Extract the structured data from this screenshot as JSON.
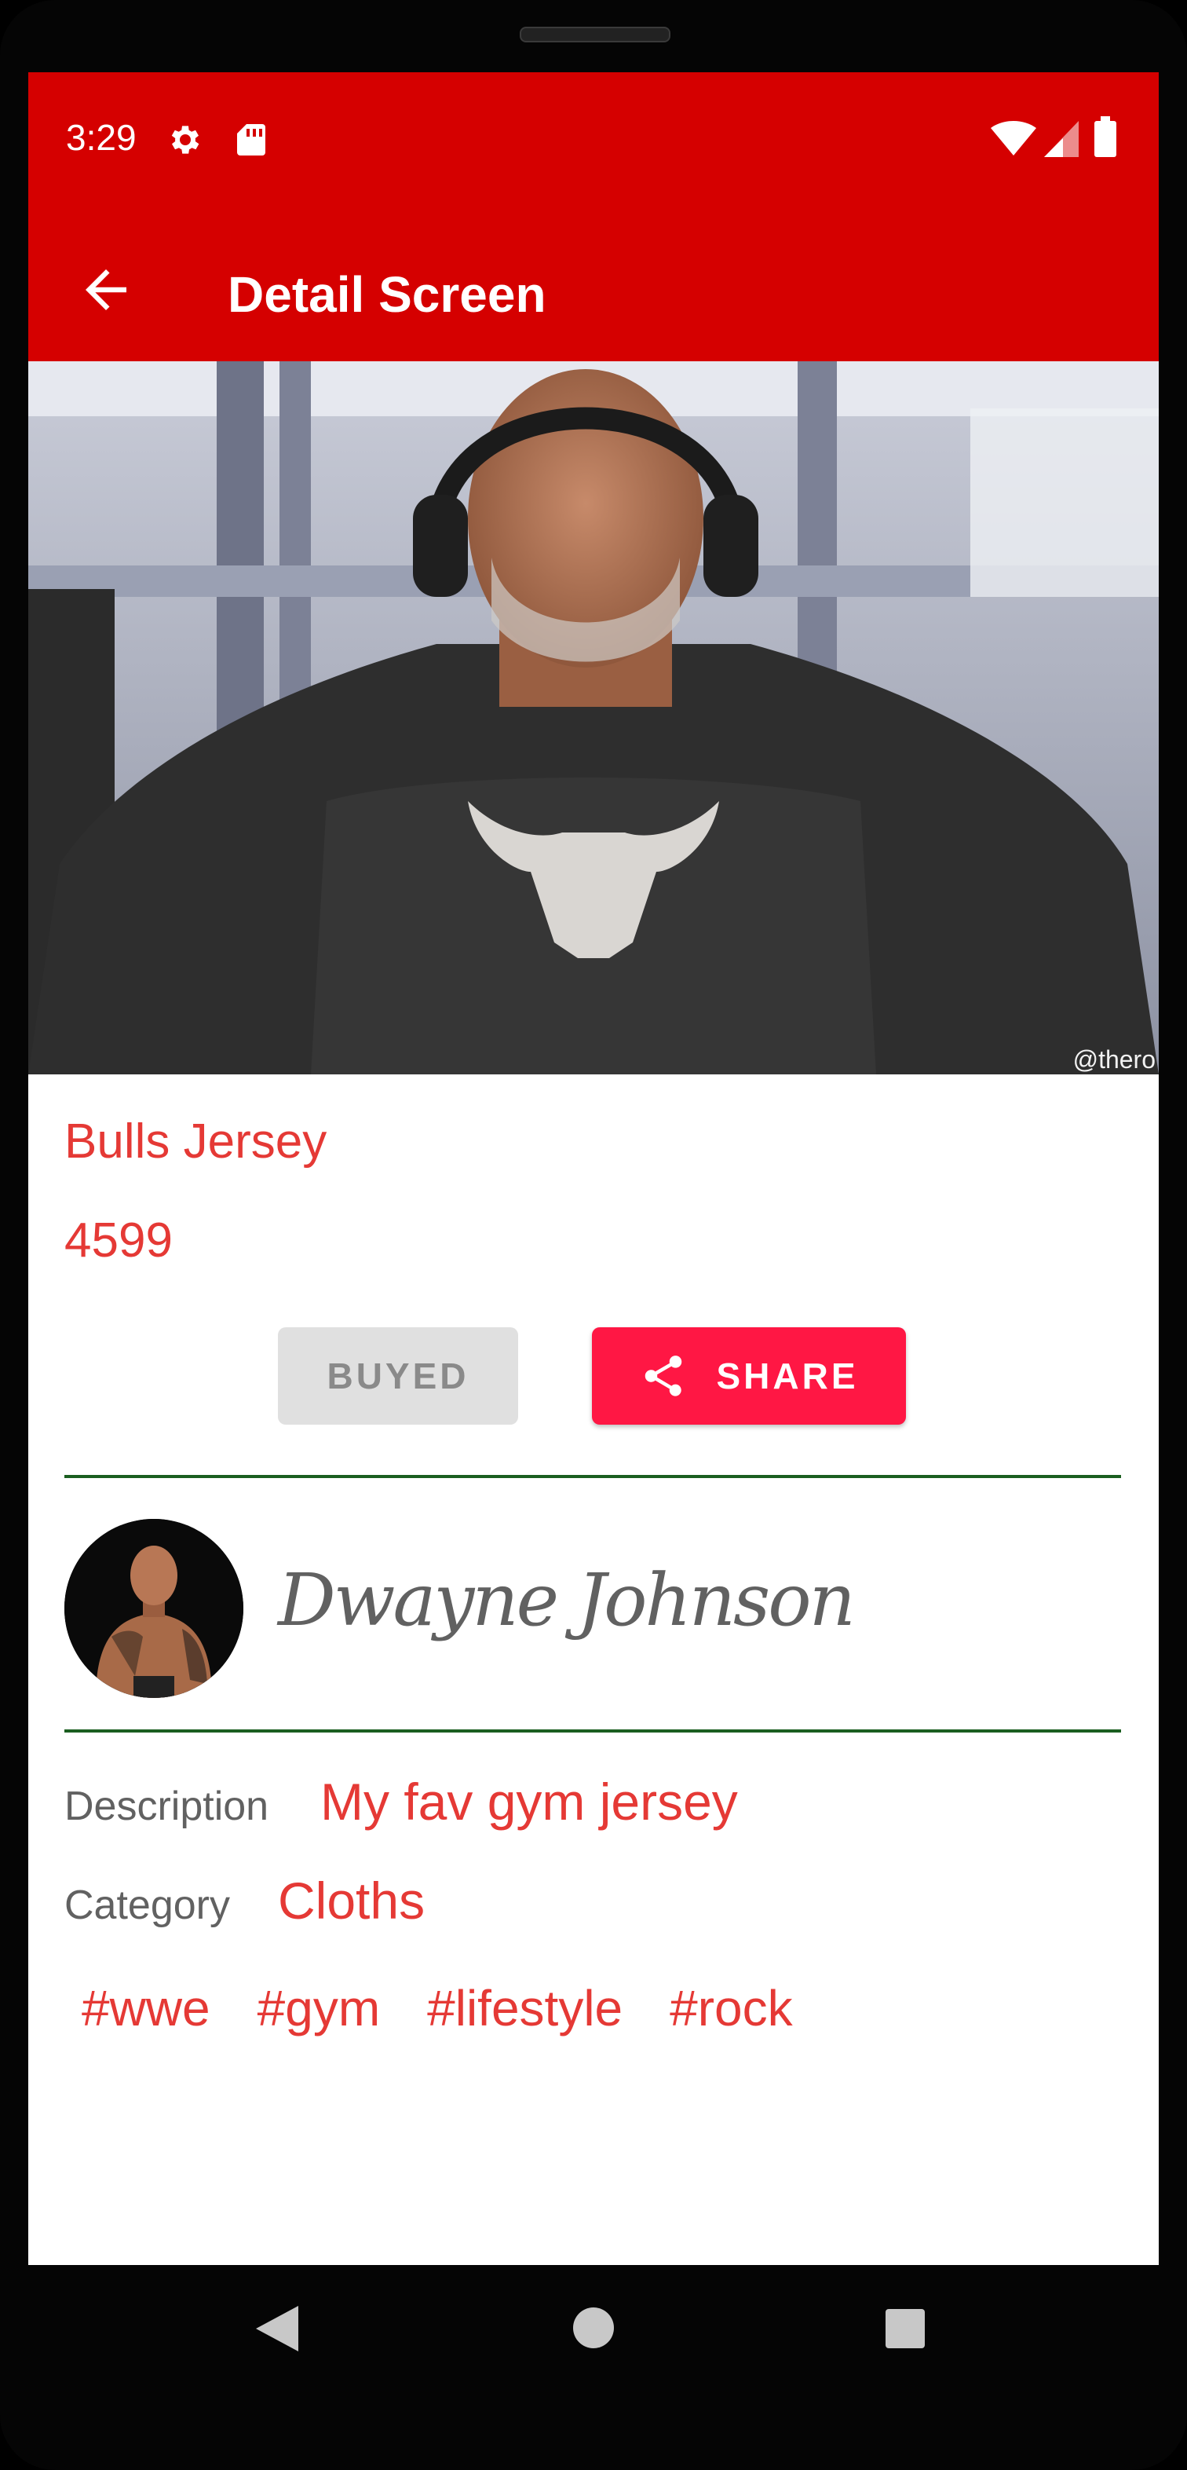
{
  "status_bar": {
    "time": "3:29",
    "left_icons": [
      "gear-icon",
      "sd-card-icon"
    ],
    "right_icons": [
      "wifi-icon",
      "signal-icon",
      "battery-icon"
    ],
    "background": "#d50000"
  },
  "app_bar": {
    "title": "Detail Screen",
    "back_icon": "arrow-left-icon",
    "background": "#d50000"
  },
  "hero_image": {
    "watermark": "@thero"
  },
  "product": {
    "title": "Bulls Jersey",
    "price": "4599"
  },
  "actions": {
    "buyed_label": "BUYED",
    "share_label": "SHARE",
    "share_icon": "share-icon"
  },
  "seller": {
    "name": "Dwayne Johnson"
  },
  "details": {
    "description_label": "Description",
    "description_value": "My fav gym jersey",
    "category_label": "Category",
    "category_value": "Cloths"
  },
  "tags": [
    "#wwe",
    "#gym",
    "#lifestyle",
    "#rock"
  ],
  "nav_bar": {
    "icons": [
      "back-triangle-icon",
      "home-circle-icon",
      "recents-square-icon"
    ]
  },
  "colors": {
    "accent": "#e53935",
    "share_button": "#ff1744",
    "divider": "#1b5e20",
    "disabled_button": "#e0e0e0"
  }
}
